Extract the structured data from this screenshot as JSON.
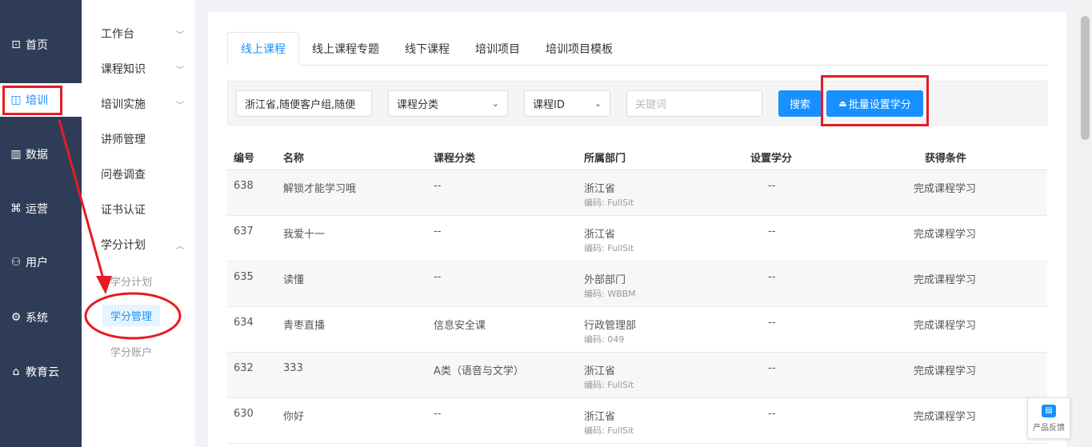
{
  "nav": {
    "items": [
      {
        "label": "首页",
        "icon": "chart-line-icon",
        "glyph": "⊡"
      },
      {
        "label": "培训",
        "icon": "book-icon",
        "glyph": "◫"
      },
      {
        "label": "数据",
        "icon": "bar-chart-icon",
        "glyph": "▥"
      },
      {
        "label": "运营",
        "icon": "command-icon",
        "glyph": "⌘"
      },
      {
        "label": "用户",
        "icon": "user-icon",
        "glyph": "⚇"
      },
      {
        "label": "系统",
        "icon": "gear-icon",
        "glyph": "⚙"
      },
      {
        "label": "教育云",
        "icon": "cloud-home-icon",
        "glyph": "⌂"
      }
    ]
  },
  "submenu": {
    "items": [
      "工作台",
      "课程知识",
      "培训实施",
      "讲师管理",
      "问卷调查",
      "证书认证",
      "学分计划"
    ],
    "children": [
      "学分计划",
      "学分管理",
      "学分账户"
    ]
  },
  "tabs": [
    "线上课程",
    "线上课程专题",
    "线下课程",
    "培训项目",
    "培训项目模板"
  ],
  "filters": {
    "org_value": "浙江省,随便客户组,随便",
    "category_select": "课程分类",
    "id_select": "课程ID",
    "keyword_placeholder": "关键词",
    "search_label": "搜索",
    "batch_label": "批量设置学分"
  },
  "table": {
    "columns": [
      "编号",
      "名称",
      "课程分类",
      "所属部门",
      "设置学分",
      "获得条件"
    ],
    "rows": [
      {
        "id": "638",
        "name": "解锁才能学习哦",
        "category": "--",
        "dept": "浙江省",
        "code": "编码: FullSit",
        "credit": "--",
        "cond": "完成课程学习"
      },
      {
        "id": "637",
        "name": "我爱十一",
        "category": "--",
        "dept": "浙江省",
        "code": "编码: FullSit",
        "credit": "--",
        "cond": "完成课程学习"
      },
      {
        "id": "635",
        "name": "读懂",
        "category": "--",
        "dept": "外部部门",
        "code": "编码: WBBM",
        "credit": "--",
        "cond": "完成课程学习"
      },
      {
        "id": "634",
        "name": "青枣直播",
        "category": "信息安全课",
        "dept": "行政管理部",
        "code": "编码: 049",
        "credit": "--",
        "cond": "完成课程学习"
      },
      {
        "id": "632",
        "name": "333",
        "category": "A类（语音与文学）",
        "dept": "浙江省",
        "code": "编码: FullSit",
        "credit": "--",
        "cond": "完成课程学习"
      },
      {
        "id": "630",
        "name": "你好",
        "category": "--",
        "dept": "浙江省",
        "code": "编码: FullSit",
        "credit": "--",
        "cond": "完成课程学习"
      }
    ]
  },
  "feedback": {
    "label": "产品反馈"
  },
  "colors": {
    "accent": "#1890ff",
    "nav_bg": "#2f3c57",
    "annotation": "#e51c23"
  }
}
